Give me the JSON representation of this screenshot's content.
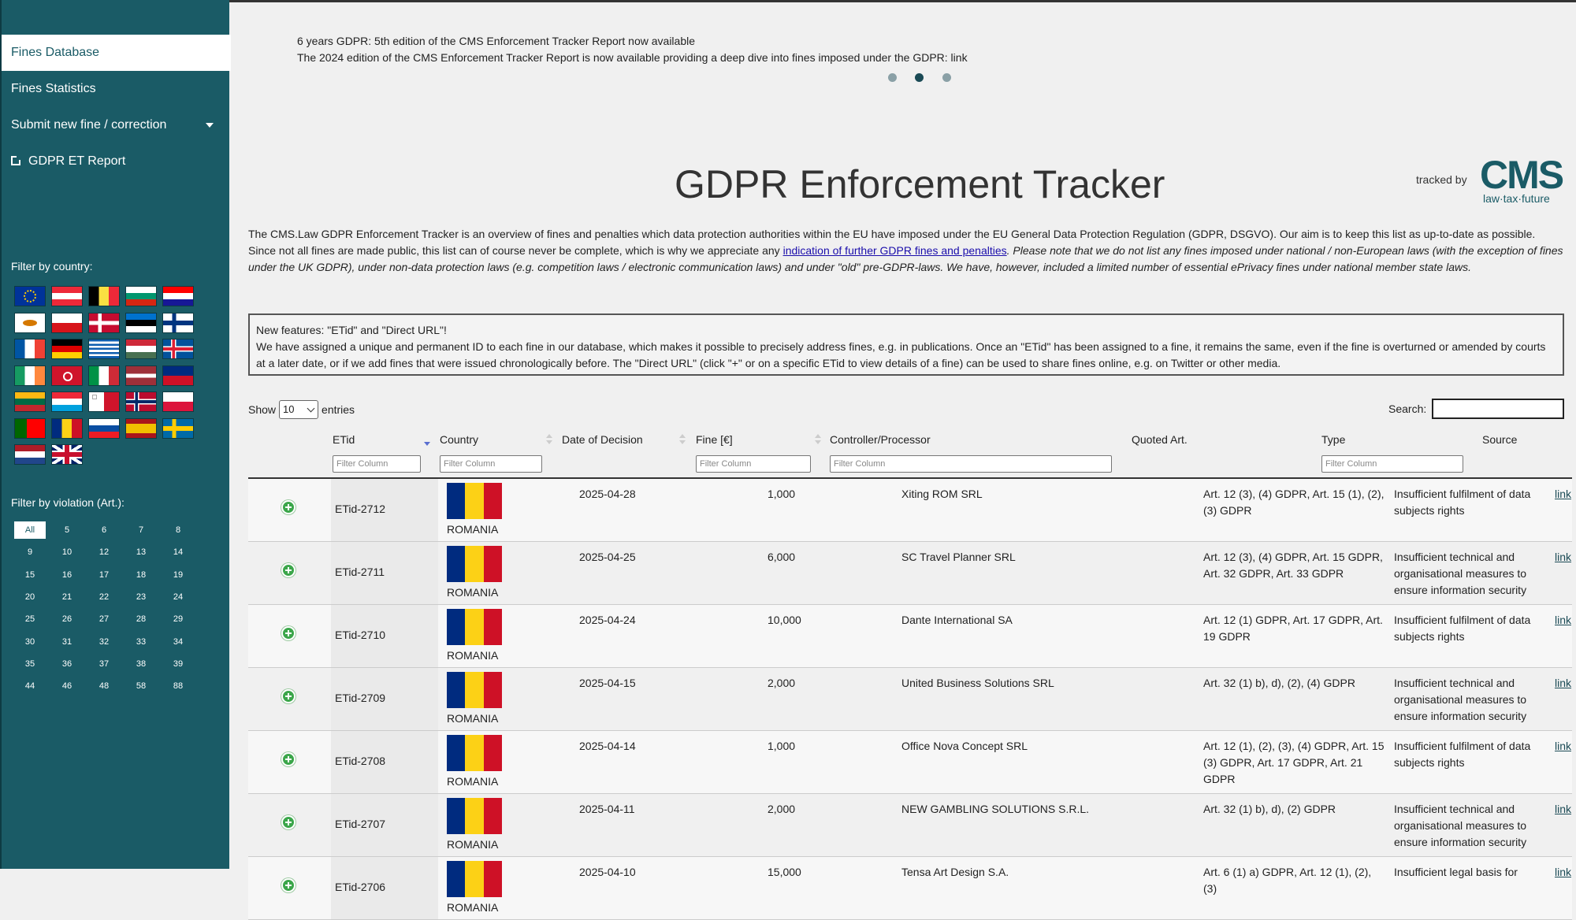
{
  "sidebar": {
    "items": [
      {
        "label": "Fines Database"
      },
      {
        "label": "Fines Statistics"
      },
      {
        "label": "Submit new fine / correction"
      },
      {
        "label": "GDPR ET Report"
      }
    ],
    "country_filter_label": "Filter by country:",
    "violation_filter_label": "Filter by violation (Art.):",
    "violations": [
      "All",
      "5",
      "6",
      "7",
      "8",
      "9",
      "10",
      "12",
      "13",
      "14",
      "15",
      "16",
      "17",
      "18",
      "19",
      "20",
      "21",
      "22",
      "23",
      "24",
      "25",
      "26",
      "27",
      "28",
      "29",
      "30",
      "31",
      "32",
      "33",
      "34",
      "35",
      "36",
      "37",
      "38",
      "39",
      "44",
      "46",
      "48",
      "58",
      "88"
    ],
    "flags": [
      "EU",
      "Austria",
      "Belgium",
      "Bulgaria",
      "Croatia",
      "Cyprus",
      "Czech Republic",
      "Denmark",
      "Estonia",
      "Finland",
      "France",
      "Germany",
      "Greece",
      "Hungary",
      "Iceland",
      "Ireland",
      "Isle of Man",
      "Italy",
      "Latvia",
      "Liechtenstein",
      "Lithuania",
      "Luxembourg",
      "Malta",
      "Norway",
      "Poland",
      "Portugal",
      "Romania",
      "Slovakia",
      "Spain",
      "Sweden",
      "Netherlands",
      "United Kingdom"
    ]
  },
  "news": {
    "line1": "6 years GDPR: 5th edition of the CMS Enforcement Tracker Report now available",
    "line2": "The 2024 edition of the CMS Enforcement Tracker Report is now available providing a deep dive into fines imposed under the GDPR: link",
    "active_dot": 2
  },
  "header": {
    "title": "GDPR Enforcement Tracker",
    "tracked_by": "tracked by",
    "logo_text": "CMS",
    "logo_tagline": "law·tax·future"
  },
  "intro": {
    "text1": "The CMS.Law GDPR Enforcement Tracker is an overview of fines and penalties which data protection authorities within the EU have imposed under the EU General Data Protection Regulation (GDPR, DSGVO). Our aim is to keep this list as up-to-date as possible. Since not all fines are made public, this list can of course never be complete, which is why we appreciate any ",
    "link": "indication of further GDPR fines and penalties",
    "italic": ". Please note that we do not list any fines imposed under national / non-European laws (with the exception of fines under the UK GDPR), under non-data protection laws (e.g. competition laws / electronic communication laws) and under \"old\" pre-GDPR-laws. We have, however, included a limited number of essential ePrivacy fines under national member state laws."
  },
  "features": {
    "heading": "New features: \"ETid\" and \"Direct URL\"!",
    "body": "We have assigned a unique and permanent ID to each fine in our database, which makes it possible to precisely address fines, e.g. in publications. Once an \"ETid\" has been assigned to a fine, it remains the same, even if the fine is overturned or amended by courts at a later date, or if we add fines that were issued chronologically before. The \"Direct URL\" (click \"+\" or on a specific ETid to view details of a fine) can be used to share fines online, e.g. on Twitter or other media."
  },
  "table_controls": {
    "show_label": "Show",
    "entries_value": "10",
    "entries_label": "entries",
    "search_label": "Search:",
    "filter_placeholder": "Filter Column"
  },
  "table": {
    "headers": [
      "ETid",
      "Country",
      "Date of Decision",
      "Fine [€]",
      "Controller/Processor",
      "Quoted Art.",
      "Type",
      "Source"
    ],
    "rows": [
      {
        "etid": "ETid-2712",
        "country": "ROMANIA",
        "date": "2025-04-28",
        "fine": "1,000",
        "controller": "Xiting ROM SRL",
        "art": "Art. 12 (3), (4) GDPR, Art. 15 (1), (2), (3) GDPR",
        "type": "Insufficient fulfilment of data subjects rights",
        "source": "link"
      },
      {
        "etid": "ETid-2711",
        "country": "ROMANIA",
        "date": "2025-04-25",
        "fine": "6,000",
        "controller": "SC Travel Planner SRL",
        "art": "Art. 12 (3), (4) GDPR, Art. 15 GDPR, Art. 32 GDPR, Art. 33 GDPR",
        "type": "Insufficient technical and organisational measures to ensure information security",
        "source": "link"
      },
      {
        "etid": "ETid-2710",
        "country": "ROMANIA",
        "date": "2025-04-24",
        "fine": "10,000",
        "controller": "Dante International SA",
        "art": "Art. 12 (1) GDPR, Art. 17 GDPR, Art. 19 GDPR",
        "type": "Insufficient fulfilment of data subjects rights",
        "source": "link"
      },
      {
        "etid": "ETid-2709",
        "country": "ROMANIA",
        "date": "2025-04-15",
        "fine": "2,000",
        "controller": "United Business Solutions SRL",
        "art": "Art. 32 (1) b), d), (2), (4) GDPR",
        "type": "Insufficient technical and organisational measures to ensure information security",
        "source": "link"
      },
      {
        "etid": "ETid-2708",
        "country": "ROMANIA",
        "date": "2025-04-14",
        "fine": "1,000",
        "controller": "Office Nova Concept SRL",
        "art": "Art. 12 (1), (2), (3), (4) GDPR, Art. 15 (3) GDPR, Art. 17 GDPR, Art. 21 GDPR",
        "type": "Insufficient fulfilment of data subjects rights",
        "source": "link"
      },
      {
        "etid": "ETid-2707",
        "country": "ROMANIA",
        "date": "2025-04-11",
        "fine": "2,000",
        "controller": "NEW GAMBLING SOLUTIONS S.R.L.",
        "art": "Art. 32 (1) b), d), (2) GDPR",
        "type": "Insufficient technical and organisational measures to ensure information security",
        "source": "link"
      },
      {
        "etid": "ETid-2706",
        "country": "ROMANIA",
        "date": "2025-04-10",
        "fine": "15,000",
        "controller": "Tensa Art Design S.A.",
        "art": "Art. 6 (1) a) GDPR, Art. 12 (1), (2), (3)",
        "type": "Insufficient legal basis for",
        "source": "link"
      }
    ]
  },
  "colors": {
    "sidebar": "#1a5b66",
    "accent": "#1a5b66",
    "plus": "#3ba64a"
  }
}
